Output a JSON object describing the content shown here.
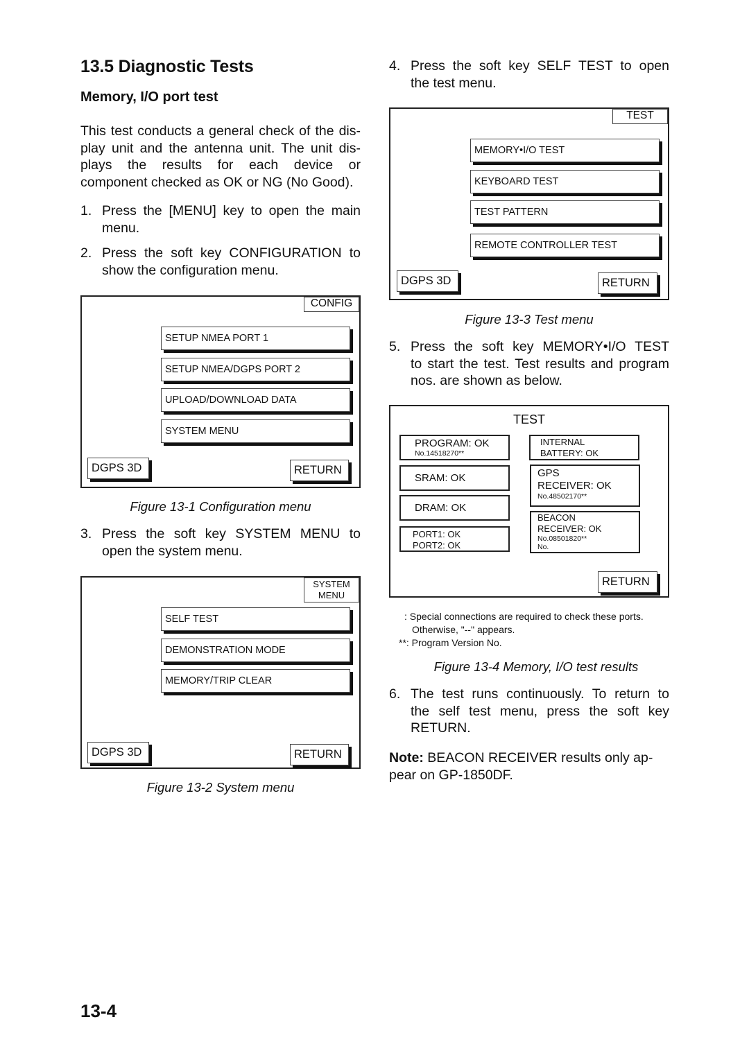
{
  "section": {
    "title": "13.5  Diagnostic Tests",
    "subtitle": "Memory, I/O port test"
  },
  "intro": {
    "lines": [
      "This test conducts a general check of the dis-",
      "play unit and the antenna unit. The unit dis-",
      "plays the results for each device or",
      "component checked as OK or NG (No Good)."
    ]
  },
  "steps": [
    {
      "num": "1.",
      "lines": [
        "Press the [MENU] key to open the main",
        "menu."
      ]
    },
    {
      "num": "2.",
      "lines": [
        "Press the soft key CONFIGURATION to",
        "show the configuration menu."
      ]
    },
    {
      "num": "3.",
      "lines": [
        "Press the soft key SYSTEM MENU to",
        "open the system menu."
      ]
    },
    {
      "num": "4.",
      "lines": [
        "Press the soft key SELF TEST to open",
        "the test menu."
      ]
    },
    {
      "num": "5.",
      "lines": [
        "Press the soft key MEMORY•I/O TEST",
        "to start the test. Test results and program",
        "nos. are shown as below."
      ]
    },
    {
      "num": "6.",
      "lines": [
        "The test runs continuously. To return to",
        "the self test menu, press the soft key",
        "RETURN."
      ]
    }
  ],
  "figures": {
    "config": {
      "tag": "CONFIG",
      "items": [
        "SETUP NMEA PORT 1",
        "SETUP NMEA/DGPS PORT 2",
        "UPLOAD/DOWNLOAD DATA",
        "SYSTEM MENU"
      ],
      "status": "DGPS 3D",
      "return": "RETURN",
      "caption": "Figure 13-1 Configuration menu"
    },
    "system": {
      "tag_line1": "SYSTEM",
      "tag_line2": "MENU",
      "items": [
        "SELF TEST",
        "DEMONSTRATION MODE",
        "MEMORY/TRIP CLEAR"
      ],
      "status": "DGPS 3D",
      "return": "RETURN",
      "caption": "Figure 13-2 System menu"
    },
    "test": {
      "tag": "TEST",
      "items": [
        "MEMORY•I/O TEST",
        "KEYBOARD TEST",
        "TEST PATTERN",
        "REMOTE CONTROLLER TEST"
      ],
      "status": "DGPS 3D",
      "return": "RETURN",
      "caption": "Figure 13-3 Test menu"
    },
    "results": {
      "title": "TEST",
      "program": {
        "label": "PROGRAM: OK",
        "no": "No.14518270**"
      },
      "sram": "SRAM: OK",
      "dram": "DRAM: OK",
      "ports": [
        "PORT1: OK",
        "PORT2: OK"
      ],
      "battery": [
        "INTERNAL",
        "BATTERY: OK"
      ],
      "gps": {
        "line1": "GPS",
        "line2": "RECEIVER: OK",
        "no": "No.48502170**"
      },
      "beacon": {
        "line1": "BEACON",
        "line2": "RECEIVER: OK",
        "no": "No.08501820**",
        "no2": "No."
      },
      "return": "RETURN",
      "caption": "Figure 13-4 Memory, I/O test results"
    }
  },
  "footnotes": [
    ": Special connections are required to check these ports.",
    "Otherwise, \"--\" appears.",
    "**: Program Version No."
  ],
  "note": {
    "label": "Note:",
    "lines": [
      " BEACON RECEIVER results only ap-",
      "pear on GP-1850DF."
    ]
  },
  "page_number": "13-4"
}
